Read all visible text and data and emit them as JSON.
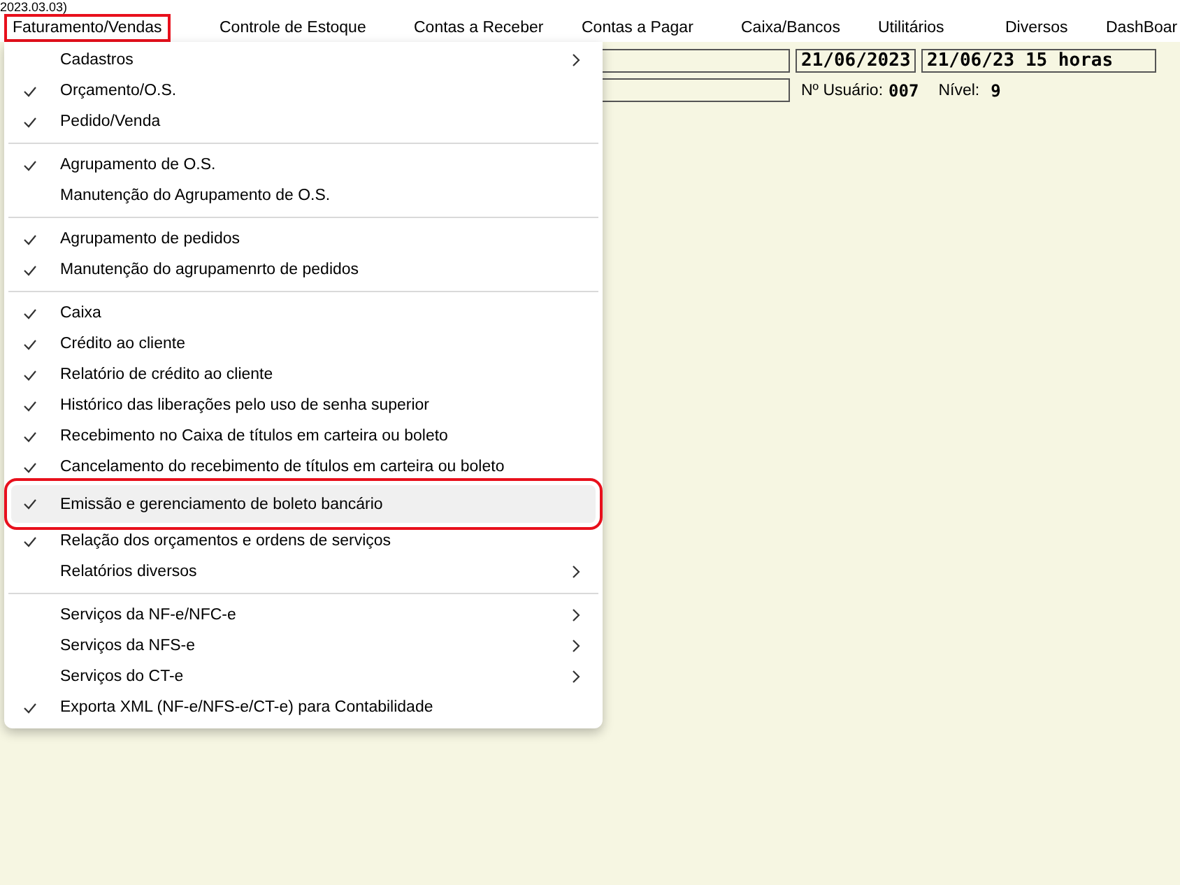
{
  "title_fragment": "2023.03.03)",
  "menu_bar": [
    {
      "label": "Faturamento/Vendas",
      "highlighted": true
    },
    {
      "label": "Controle de Estoque",
      "highlighted": false
    },
    {
      "label": "Contas a Receber",
      "highlighted": false
    },
    {
      "label": "Contas a Pagar",
      "highlighted": false
    },
    {
      "label": "Caixa/Bancos",
      "highlighted": false
    },
    {
      "label": "Utilitários",
      "highlighted": false
    },
    {
      "label": "Diversos",
      "highlighted": false
    },
    {
      "label": "DashBoar",
      "highlighted": false
    }
  ],
  "menu": [
    {
      "kind": "item",
      "label": "Cadastros",
      "checked": false,
      "submenu": true,
      "highlighted": false
    },
    {
      "kind": "item",
      "label": "Orçamento/O.S.",
      "checked": true,
      "submenu": false,
      "highlighted": false
    },
    {
      "kind": "item",
      "label": "Pedido/Venda",
      "checked": true,
      "submenu": false,
      "highlighted": false
    },
    {
      "kind": "separator"
    },
    {
      "kind": "item",
      "label": "Agrupamento de O.S.",
      "checked": true,
      "submenu": false,
      "highlighted": false
    },
    {
      "kind": "item",
      "label": "Manutenção do Agrupamento de O.S.",
      "checked": false,
      "submenu": false,
      "highlighted": false
    },
    {
      "kind": "separator"
    },
    {
      "kind": "item",
      "label": "Agrupamento de pedidos",
      "checked": true,
      "submenu": false,
      "highlighted": false
    },
    {
      "kind": "item",
      "label": "Manutenção do agrupamenrto de pedidos",
      "checked": true,
      "submenu": false,
      "highlighted": false
    },
    {
      "kind": "separator"
    },
    {
      "kind": "item",
      "label": "Caixa",
      "checked": true,
      "submenu": false,
      "highlighted": false
    },
    {
      "kind": "item",
      "label": "Crédito ao cliente",
      "checked": true,
      "submenu": false,
      "highlighted": false
    },
    {
      "kind": "item",
      "label": "Relatório de crédito ao cliente",
      "checked": true,
      "submenu": false,
      "highlighted": false
    },
    {
      "kind": "item",
      "label": "Histórico das liberações pelo uso de senha superior",
      "checked": true,
      "submenu": false,
      "highlighted": false
    },
    {
      "kind": "item",
      "label": "Recebimento no Caixa de títulos em carteira ou boleto",
      "checked": true,
      "submenu": false,
      "highlighted": false
    },
    {
      "kind": "item",
      "label": "Cancelamento do recebimento de títulos em carteira ou boleto",
      "checked": true,
      "submenu": false,
      "highlighted": false
    },
    {
      "kind": "item",
      "label": "Emissão e gerenciamento de boleto bancário",
      "checked": true,
      "submenu": false,
      "highlighted": true
    },
    {
      "kind": "item",
      "label": "Relação dos orçamentos e ordens de serviços",
      "checked": true,
      "submenu": false,
      "highlighted": false
    },
    {
      "kind": "item",
      "label": "Relatórios diversos",
      "checked": false,
      "submenu": true,
      "highlighted": false
    },
    {
      "kind": "separator"
    },
    {
      "kind": "item",
      "label": "Serviços da NF-e/NFC-e",
      "checked": false,
      "submenu": true,
      "highlighted": false
    },
    {
      "kind": "item",
      "label": "Serviços da NFS-e",
      "checked": false,
      "submenu": true,
      "highlighted": false
    },
    {
      "kind": "item",
      "label": "Serviços do CT-e",
      "checked": false,
      "submenu": true,
      "highlighted": false
    },
    {
      "kind": "item",
      "label": "Exporta XML (NF-e/NFS-e/CT-e) para Contabilidade",
      "checked": true,
      "submenu": false,
      "highlighted": false
    }
  ],
  "status": {
    "date": "21/06/2023",
    "datetime": "21/06/23 15 horas",
    "user_label": "Nº Usuário:",
    "user_value": "007",
    "level_label": "Nível:",
    "level_value": "9"
  }
}
